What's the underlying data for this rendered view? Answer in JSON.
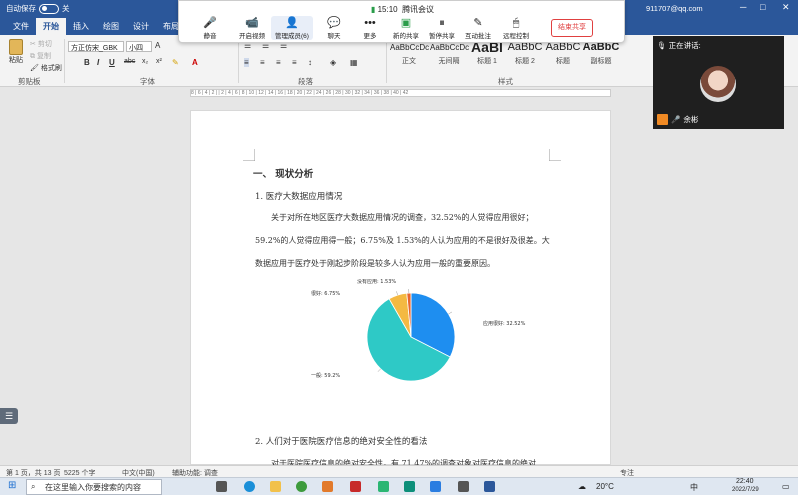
{
  "titlebar": {
    "autosave_label": "自动保存",
    "autosave_state": "关",
    "account": "911707@qq.com"
  },
  "ribbon_tabs": [
    "文件",
    "开始",
    "插入",
    "绘图",
    "设计",
    "布局"
  ],
  "clipboard": {
    "paste": "粘贴",
    "cut": "剪切",
    "copy": "复制",
    "format_painter": "格式刷",
    "group_label": "剪贴板"
  },
  "font": {
    "name": "方正仿宋_GBK",
    "size": "小四",
    "group_label": "字体",
    "buttons": [
      "B",
      "I",
      "U",
      "abc",
      "x₂",
      "x²",
      "A"
    ]
  },
  "paragraph": {
    "group_label": "段落"
  },
  "styles": {
    "group_label": "样式",
    "items": [
      {
        "sample": "AaBbCcDc",
        "name": "正文"
      },
      {
        "sample": "AaBbCcDc",
        "name": "无间隔"
      },
      {
        "sample": "AaBl",
        "name": "标题 1"
      },
      {
        "sample": "AaBbC",
        "name": "标题 2"
      },
      {
        "sample": "AaBbC",
        "name": "标题"
      },
      {
        "sample": "AaBbC",
        "name": "副标题"
      }
    ]
  },
  "ruler_text": "8 | 6 | 4 | 2 | | 2 | 4 | 6 | 8 | 10 | 12 | 14 | 16 | 18 | 20 | 22 | 24 | 26 | 28 | 30 | 32 | 34 | 36 | 38 | 40 | 42",
  "meeting": {
    "time": "15:10",
    "app": "腾讯会议",
    "items": [
      "静音",
      "开启视频",
      "管理成员(6)",
      "聊天",
      "更多",
      "新的共享",
      "暂停共享",
      "互动批注",
      "远程控制"
    ],
    "end_label": "结束共享"
  },
  "speaker": {
    "header": "正在讲话:",
    "name": "余彬"
  },
  "document": {
    "heading1": "一、   现状分析",
    "heading2_1": "1.  医疗大数据应用情况",
    "para1_line1": "关于对所在地区医疗大数据应用情况的调查，32.52%的人觉得应用很好；",
    "para1_line2": "59.2%的人觉得应用得一般；6.75%及 1.53%的人认为应用的不是很好及很差。大",
    "para1_line3": "数据应用于医疗处于刚起步阶段是较多人认为应用一般的重要原因。",
    "heading2_2": "2.  人们对于医院医疗信息的绝对安全性的看法",
    "para2_line1": "对于医院医疗信息的绝对安全性，有 71.47%的调查对象对医疗信息的绝对"
  },
  "chart_data": {
    "type": "pie",
    "slices": [
      {
        "label": "应用很好: 32.52%",
        "value": 32.52,
        "color": "#1e8ef0"
      },
      {
        "label": "应用一般: 59.2%",
        "value": 59.2,
        "color": "#2ec9c6"
      },
      {
        "label": "应用不是很好: 6.75%",
        "value": 6.75,
        "color": "#f4b942"
      },
      {
        "label": "没有应用: 1.53%",
        "value": 1.53,
        "color": "#e8662f"
      }
    ]
  },
  "statusbar": {
    "page": "第 1 页，共 13 页",
    "words": "5225 个字",
    "lang": "中文(中国)",
    "access": "辅助功能: 调查",
    "focus": "专注"
  },
  "taskbar": {
    "search_placeholder": "在这里输入你要搜索的内容",
    "temperature": "20°C",
    "ime": "中",
    "clock_time": "22:40",
    "clock_date": "2022/7/29"
  }
}
